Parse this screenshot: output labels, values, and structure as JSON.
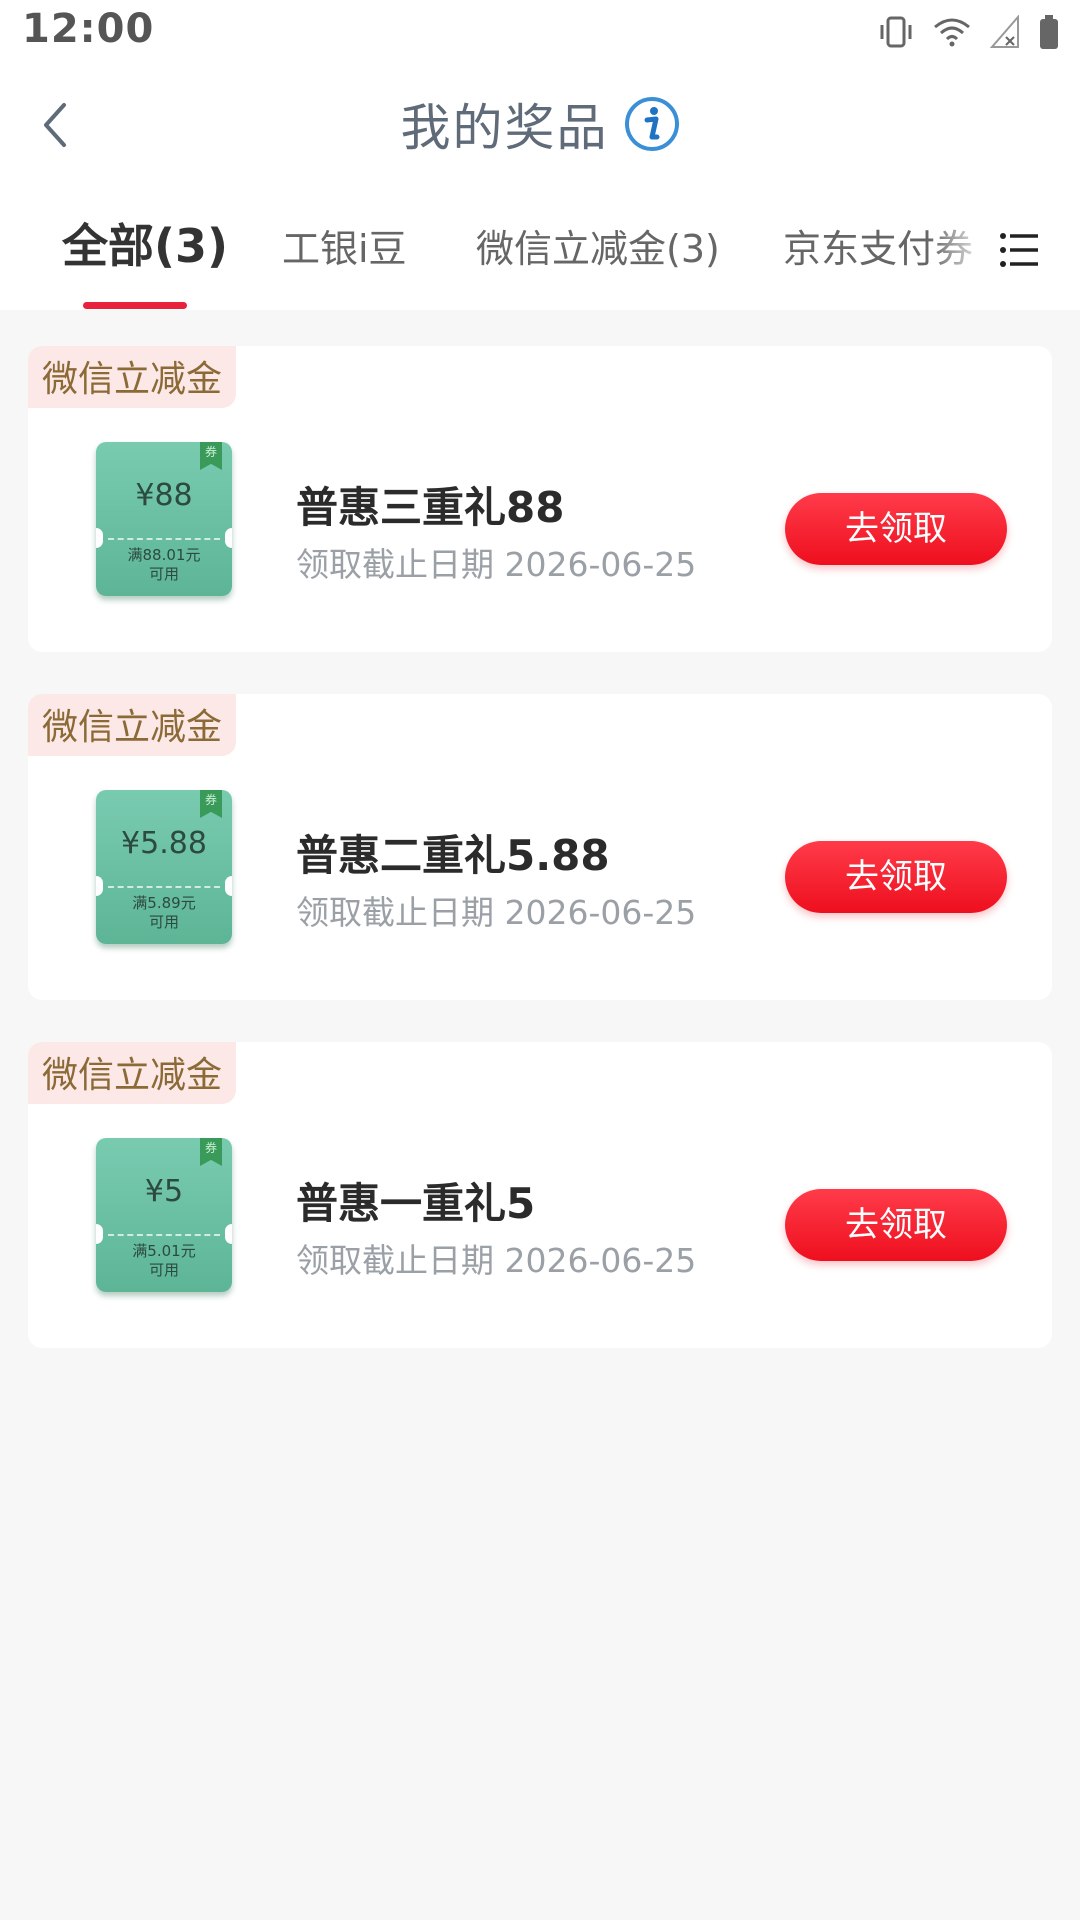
{
  "status_bar": {
    "time": "12:00",
    "icons": [
      "vibrate-icon",
      "wifi-icon",
      "signal-icon",
      "battery-icon"
    ]
  },
  "header": {
    "title": "我的奖品",
    "back_icon": "chevron-left-icon",
    "info_icon": "info-icon"
  },
  "tabs": [
    {
      "label": "全部(3)",
      "active": true
    },
    {
      "label": "工银i豆",
      "active": false
    },
    {
      "label": "微信立减金(3)",
      "active": false
    },
    {
      "label": "京东支付券",
      "active": false
    }
  ],
  "menu_icon": "list-menu-icon",
  "prizes": [
    {
      "tag": "微信立减金",
      "coupon_amount": "¥88",
      "coupon_condition": "满88.01元",
      "coupon_usable": "可用",
      "coupon_badge": "券",
      "name": "普惠三重礼88",
      "deadline": "领取截止日期 2026-06-25",
      "button": "去领取"
    },
    {
      "tag": "微信立减金",
      "coupon_amount": "¥5.88",
      "coupon_condition": "满5.89元",
      "coupon_usable": "可用",
      "coupon_badge": "券",
      "name": "普惠二重礼5.88",
      "deadline": "领取截止日期 2026-06-25",
      "button": "去领取"
    },
    {
      "tag": "微信立减金",
      "coupon_amount": "¥5",
      "coupon_condition": "满5.01元",
      "coupon_usable": "可用",
      "coupon_badge": "券",
      "name": "普惠一重礼5",
      "deadline": "领取截止日期 2026-06-25",
      "button": "去领取"
    }
  ],
  "colors": {
    "accent_red": "#e8223d",
    "tag_bg": "#fde8e8",
    "tag_text": "#8b6a36",
    "coupon_green": "#5db596"
  }
}
